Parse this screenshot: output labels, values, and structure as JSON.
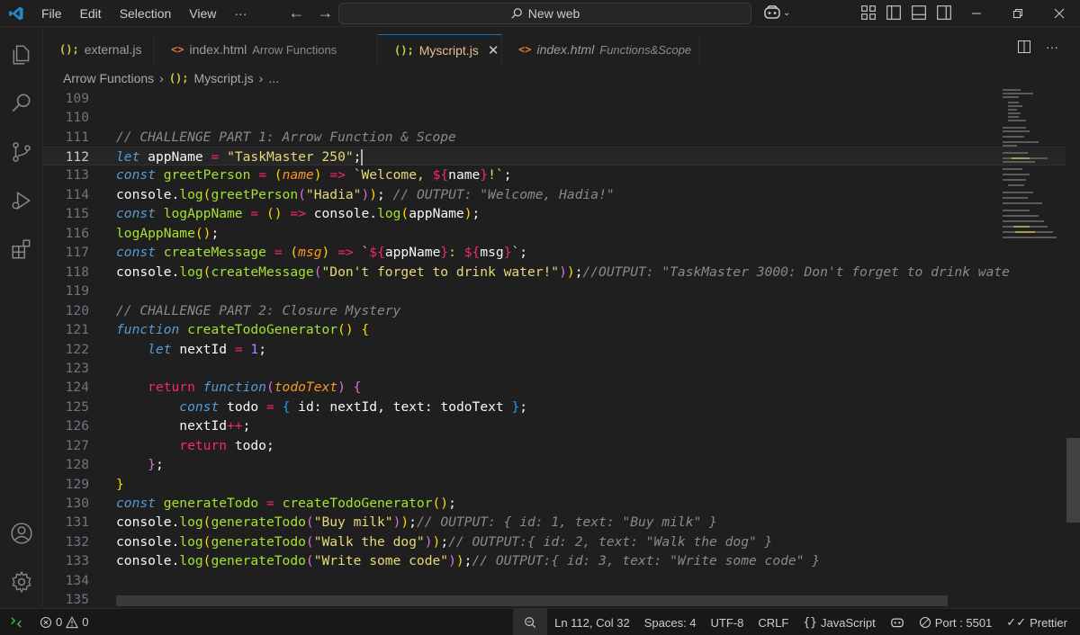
{
  "menu": {
    "file": "File",
    "edit": "Edit",
    "selection": "Selection",
    "view": "View",
    "more": "···"
  },
  "command_center": {
    "label": "New web"
  },
  "tabs": [
    {
      "icon": "(){}",
      "iconText": "(); ",
      "name": "external.js",
      "desc": "",
      "active": false,
      "color": "#cbcb41"
    },
    {
      "iconText": "<>",
      "name": "index.html",
      "desc": "Arrow Functions",
      "active": false,
      "color": "#e37933"
    },
    {
      "iconText": "(); ",
      "name": "Myscript.js",
      "desc": "",
      "active": true,
      "color": "#cbcb41"
    },
    {
      "iconText": "<>",
      "name": "index.html",
      "desc": "Functions&Scope",
      "active": false,
      "color": "#e37933"
    }
  ],
  "breadcrumb": {
    "folder": "Arrow Functions",
    "file_icon": "();",
    "file": "Myscript.js",
    "more": "..."
  },
  "editor": {
    "current_line": 112,
    "lines": [
      {
        "n": "109"
      },
      {
        "n": "110"
      },
      {
        "n": "111"
      },
      {
        "n": "112"
      },
      {
        "n": "113"
      },
      {
        "n": "114"
      },
      {
        "n": "115"
      },
      {
        "n": "116"
      },
      {
        "n": "117"
      },
      {
        "n": "118"
      },
      {
        "n": "119"
      },
      {
        "n": "120"
      },
      {
        "n": "121"
      },
      {
        "n": "122"
      },
      {
        "n": "123"
      },
      {
        "n": "124"
      },
      {
        "n": "125"
      },
      {
        "n": "126"
      },
      {
        "n": "127"
      },
      {
        "n": "128"
      },
      {
        "n": "129"
      },
      {
        "n": "130"
      },
      {
        "n": "131"
      },
      {
        "n": "132"
      },
      {
        "n": "133"
      },
      {
        "n": "134"
      },
      {
        "n": "135"
      }
    ],
    "code": {
      "l111": "// CHALLENGE PART 1: Arrow Function & Scope",
      "l112_kw": "let",
      "l112_var": "appName",
      "l112_str": "\"TaskMaster 250\"",
      "l113_kw": "const",
      "l113_fn": "greetPerson",
      "l113_prm": "name",
      "l113_tpl1": "`Welcome, ",
      "l113_tplv": "name",
      "l113_tpl2": "!`",
      "l114_obj": "console",
      "l114_fn": "log",
      "l114_fn2": "greetPerson",
      "l114_str": "\"Hadia\"",
      "l114_cm": "// OUTPUT: \"Welcome, Hadia!\"",
      "l115_kw": "const",
      "l115_fn": "logAppName",
      "l115_obj": "console",
      "l115_log": "log",
      "l115_var": "appName",
      "l116_fn": "logAppName",
      "l117_kw": "const",
      "l117_fn": "createMessage",
      "l117_prm": "msg",
      "l117_v1": "appName",
      "l117_v2": "msg",
      "l118_obj": "console",
      "l118_log": "log",
      "l118_fn": "createMessage",
      "l118_str": "\"Don't forget to drink water!\"",
      "l118_cm": "//OUTPUT: \"TaskMaster 3000: Don't forget to drink wate",
      "l120": "// CHALLENGE PART 2: Closure Mystery",
      "l121_kw": "function",
      "l121_fn": "createTodoGenerator",
      "l122_kw": "let",
      "l122_var": "nextId",
      "l122_num": "1",
      "l124_ret": "return",
      "l124_kw": "function",
      "l124_prm": "todoText",
      "l125_kw": "const",
      "l125_var": "todo",
      "l125_k1": "id",
      "l125_v1": "nextId",
      "l125_k2": "text",
      "l125_v2": "todoText",
      "l126_var": "nextId",
      "l127_ret": "return",
      "l127_var": "todo",
      "l130_kw": "const",
      "l130_var": "generateTodo",
      "l130_fn": "createTodoGenerator",
      "l131_obj": "console",
      "l131_log": "log",
      "l131_fn": "generateTodo",
      "l131_str": "\"Buy milk\"",
      "l131_cm": "// OUTPUT: { id: 1, text: \"Buy milk\" }",
      "l132_obj": "console",
      "l132_log": "log",
      "l132_fn": "generateTodo",
      "l132_str": "\"Walk the dog\"",
      "l132_cm": "// OUTPUT:{ id: 2, text: \"Walk the dog\" }",
      "l133_obj": "console",
      "l133_log": "log",
      "l133_fn": "generateTodo",
      "l133_str": "\"Write some code\"",
      "l133_cm": "// OUTPUT:{ id: 3, text: \"Write some code\" }"
    }
  },
  "status": {
    "errors": "0",
    "warnings": "0",
    "position": "Ln 112, Col 32",
    "spaces": "Spaces: 4",
    "encoding": "UTF-8",
    "eol": "CRLF",
    "language": "JavaScript",
    "port": "Port : 5501",
    "prettier": "Prettier"
  },
  "colors": {
    "accent": "#0078d4",
    "background": "#1f1f1f"
  }
}
